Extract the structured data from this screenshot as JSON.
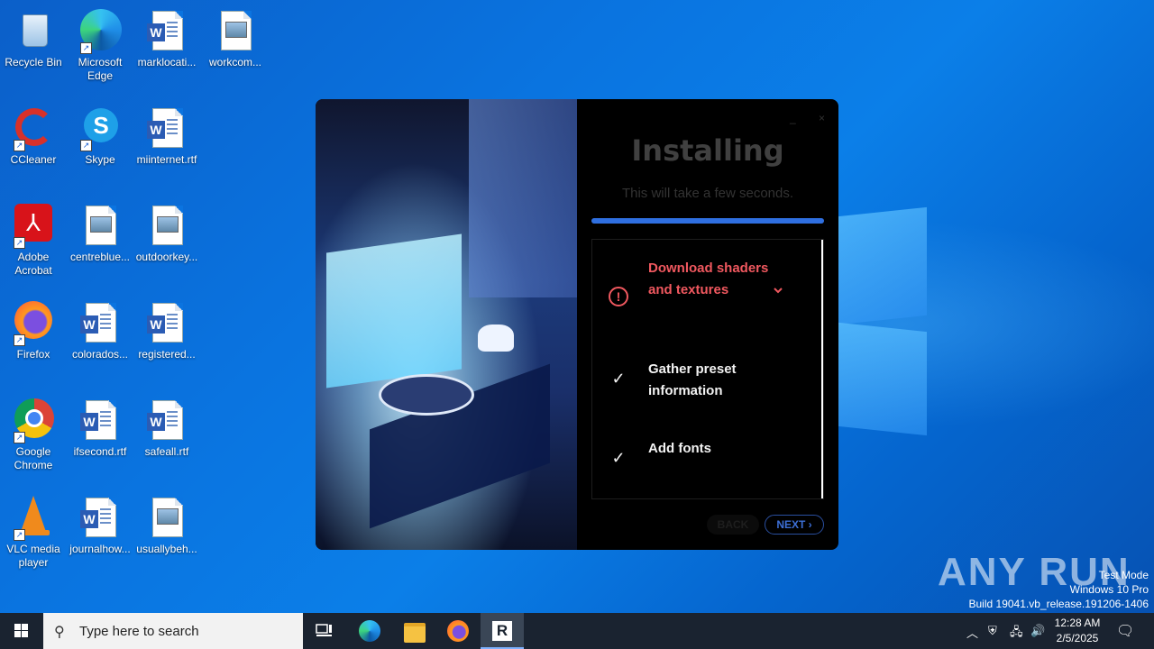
{
  "desktop": {
    "icons": [
      {
        "label": "Recycle Bin"
      },
      {
        "label": "Microsoft Edge"
      },
      {
        "label": "marklocati..."
      },
      {
        "label": "workcom..."
      },
      {
        "label": "CCleaner"
      },
      {
        "label": "Skype"
      },
      {
        "label": "miinternet.rtf"
      },
      {
        "label": "Adobe Acrobat"
      },
      {
        "label": "centreblue..."
      },
      {
        "label": "outdoorkey..."
      },
      {
        "label": "Firefox"
      },
      {
        "label": "colorados..."
      },
      {
        "label": "registered..."
      },
      {
        "label": "Google Chrome"
      },
      {
        "label": "ifsecond.rtf"
      },
      {
        "label": "safeall.rtf"
      },
      {
        "label": "VLC media player"
      },
      {
        "label": "journalhow..."
      },
      {
        "label": "usuallybeh..."
      }
    ]
  },
  "installer": {
    "title": "Installing",
    "subtitle": "This will take a few seconds.",
    "progress_fraction": 1.0,
    "steps": [
      {
        "label": "Download shaders and textures",
        "status": "error"
      },
      {
        "label": "Gather preset information",
        "status": "done"
      },
      {
        "label": "Add fonts",
        "status": "done"
      }
    ],
    "back_label": "BACK",
    "next_label": "NEXT",
    "minimize_glyph": "_",
    "close_glyph": "×"
  },
  "watermark": {
    "brand": "ANY RUN",
    "line1": "Test Mode",
    "line2": "Windows 10 Pro",
    "line3": "Build 19041.vb_release.191206-1406"
  },
  "taskbar": {
    "search_placeholder": "Type here to search",
    "time": "12:28 AM",
    "date": "2/5/2025"
  },
  "colors": {
    "error": "#f0585f",
    "accent": "#2f6fe0",
    "desktop": "#0a74e0"
  }
}
